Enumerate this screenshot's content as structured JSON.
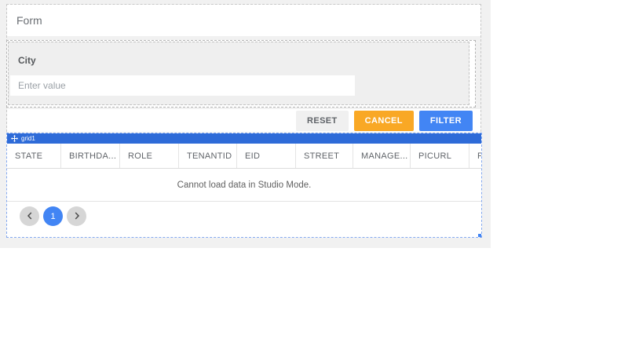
{
  "form": {
    "title": "Form",
    "field": {
      "label": "City",
      "placeholder": "Enter value",
      "value": ""
    },
    "buttons": {
      "reset": "RESET",
      "cancel": "CANCEL",
      "filter": "FILTER"
    }
  },
  "grid": {
    "tag": "grid1",
    "columns": [
      "STATE",
      "BIRTHDA...",
      "ROLE",
      "TENANTID",
      "EID",
      "STREET",
      "MANAGE...",
      "PICURL",
      "F"
    ],
    "message": "Cannot load data in Studio Mode.",
    "pagination": {
      "current_page": "1"
    }
  },
  "colors": {
    "canvas_background": "#f1f1f1",
    "cancel_button": "#f9a825",
    "filter_button": "#4285f4",
    "grid_tag_bar": "#2e6bd8",
    "active_page": "#4285f4",
    "selection_dashed_border": "#85a9ef"
  }
}
